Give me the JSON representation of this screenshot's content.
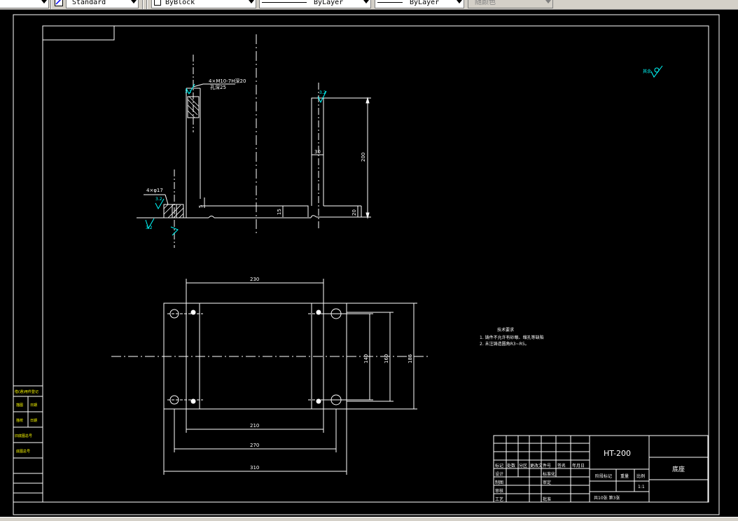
{
  "toolbar": {
    "text_style": "Standard",
    "layer_block": "ByBlock",
    "linetype": "ByLayer",
    "lineweight": "ByLayer",
    "plot_style": "随颜色"
  },
  "drawing": {
    "roughness_tolerance": "4×M10-7H深20",
    "thread_depth": "孔深25",
    "hole_callout": "4×φ17",
    "roughness_values": [
      "3.2",
      "3.2",
      "3.2",
      "3.2"
    ],
    "other_roughness_label": "其余",
    "front_dims": {
      "height_200": "200",
      "width_30": "30",
      "base_15": "15",
      "chamfer_5": "5",
      "base_20": "20"
    },
    "plan_dims": {
      "top_230": "230",
      "w210": "210",
      "w270": "270",
      "w310": "310",
      "h140": "140",
      "h160": "160",
      "h185": "185"
    }
  },
  "notes": {
    "title": "技术要求",
    "items": [
      "1. 铸件不允许有砂眼、缩孔等缺陷",
      "2. 未注铸造圆角R3~R5。"
    ]
  },
  "side_table": {
    "rows": [
      "借(通)用件登记",
      "描图",
      "描校",
      "旧底图总号",
      "底图总号"
    ],
    "sign": "签字",
    "date": "日期"
  },
  "title_block": {
    "part_number": "HT-200",
    "part_name": "底座",
    "header_cells": [
      "标记",
      "处数",
      "分区",
      "更改文件号",
      "签名",
      "年月日"
    ],
    "role_rows": [
      "设计",
      "制图",
      "审核",
      "工艺"
    ],
    "mid_roles": [
      "标准化",
      "审定",
      "",
      "批准"
    ],
    "stage_label": "阶段标记",
    "weight_label": "重量",
    "scale_label": "比例",
    "scale_value": "1:1",
    "sheet_info": "共10张 第3张"
  }
}
